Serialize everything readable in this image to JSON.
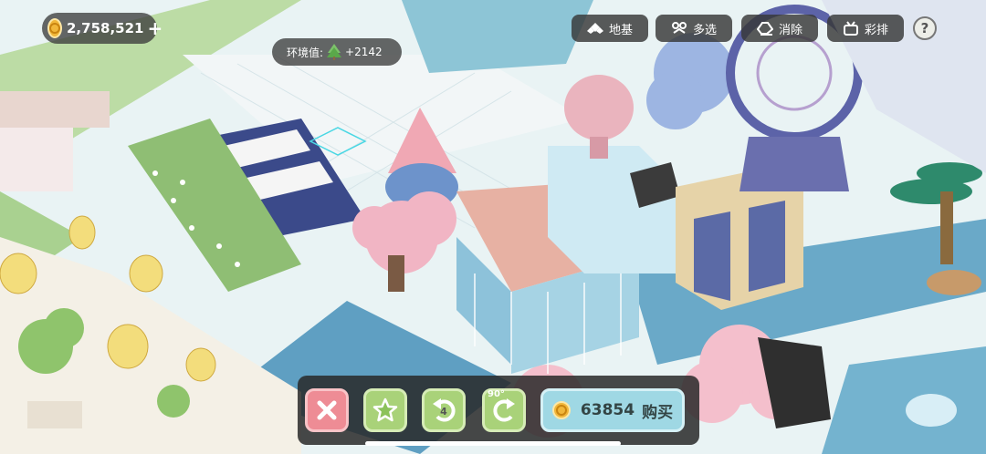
{
  "hud": {
    "coins": "2,758,521",
    "coin_plus": "+",
    "env_label": "环境值:",
    "env_value": "+2142"
  },
  "toolbar": {
    "foundation_label": "地基",
    "multiselect_label": "多选",
    "erase_label": "消除",
    "rehearse_label": "彩排",
    "help_label": "?"
  },
  "actions": {
    "undo_count": "4",
    "rotate_label": "90°",
    "price": "63854",
    "buy_label": "购买"
  },
  "colors": {
    "hud_bg": "#3c3c3c",
    "cancel": "#ee8c95",
    "green_btn": "#a9d279",
    "buy_btn": "#9fd8e4"
  },
  "icons": [
    "coin-icon",
    "tree-icon",
    "foundation-icon",
    "multiselect-icon",
    "eraser-icon",
    "rehearse-icon",
    "help-icon",
    "close-icon",
    "star-icon",
    "undo-icon",
    "rotate-icon"
  ]
}
